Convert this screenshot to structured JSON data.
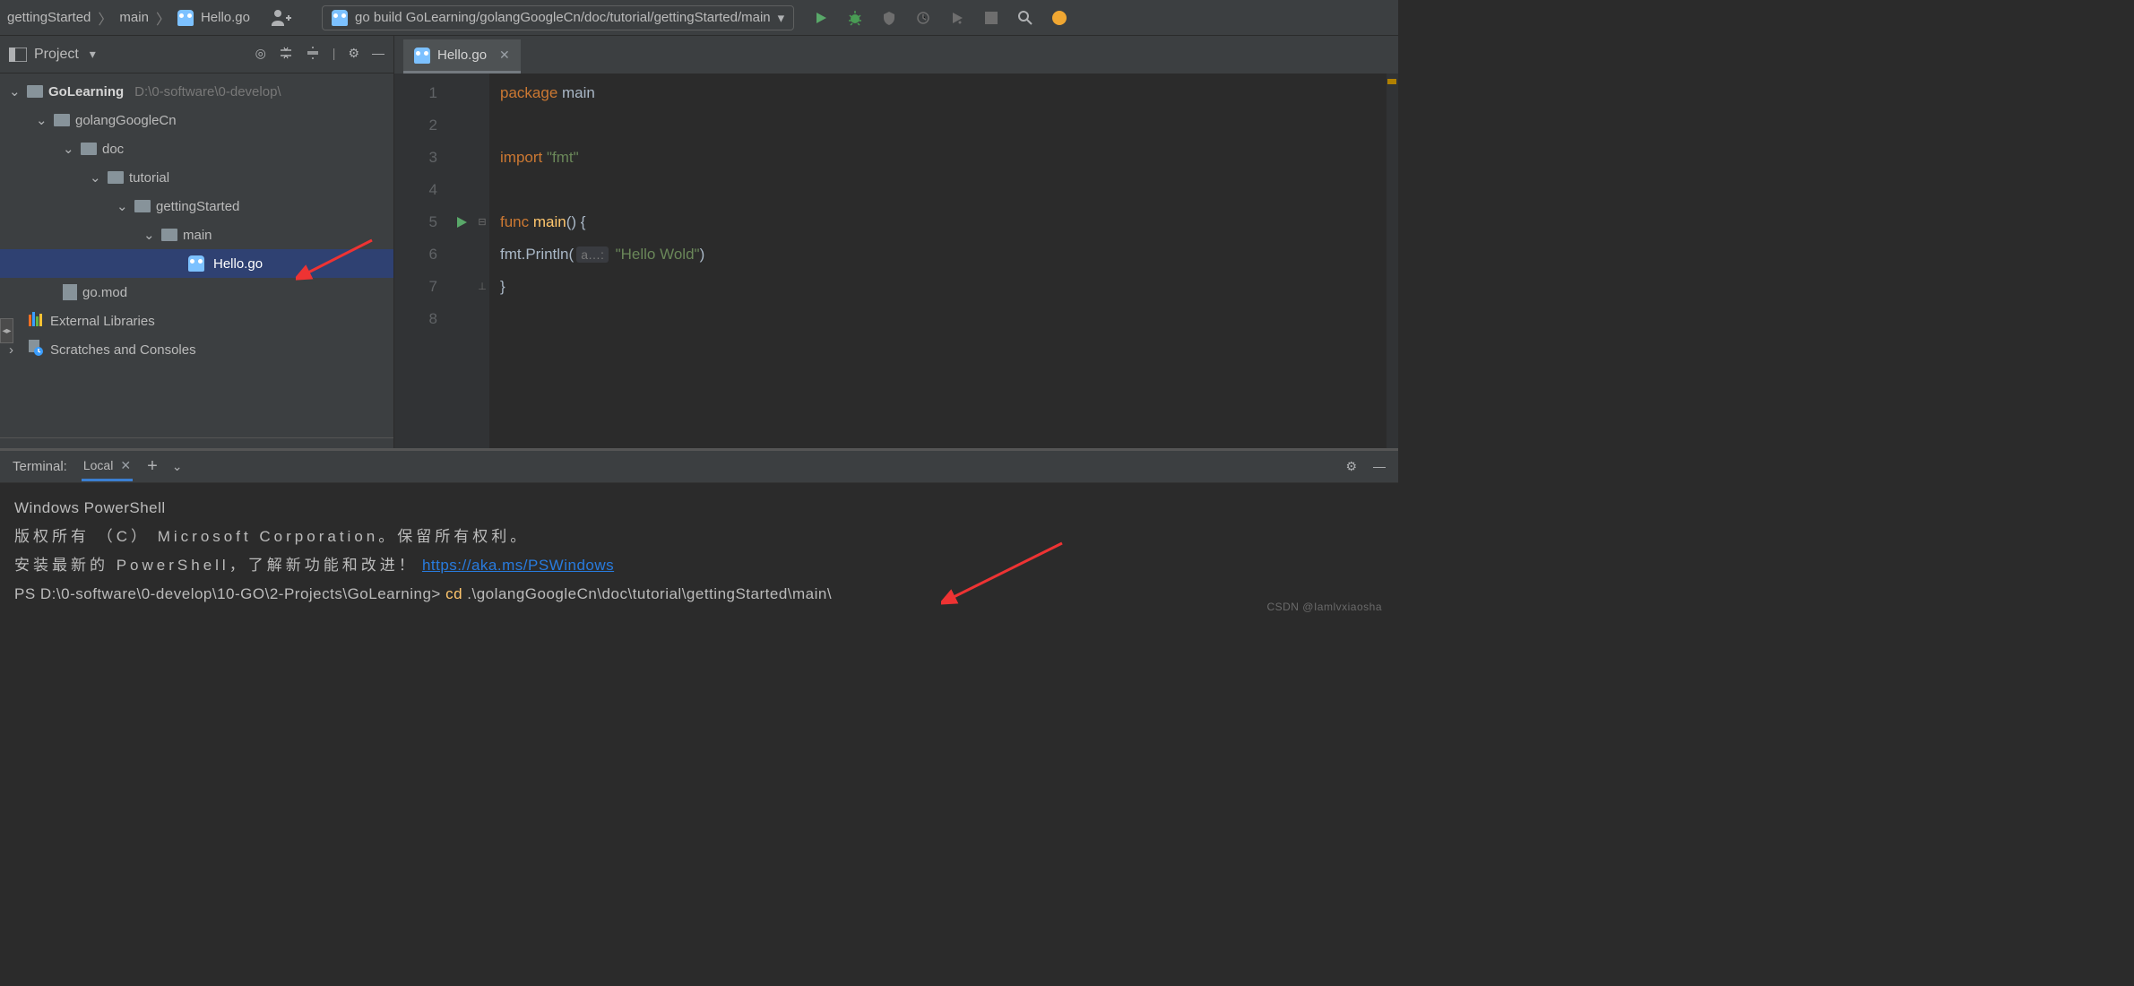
{
  "breadcrumb": {
    "p1": "gettingStarted",
    "p2": "main",
    "p3": "Hello.go"
  },
  "run_config": {
    "label": "go build GoLearning/golangGoogleCn/doc/tutorial/gettingStarted/main"
  },
  "project_panel": {
    "title": "Project"
  },
  "tree": {
    "root": "GoLearning",
    "root_path": "D:\\0-software\\0-develop\\",
    "n1": "golangGoogleCn",
    "n2": "doc",
    "n3": "tutorial",
    "n4": "gettingStarted",
    "n5": "main",
    "file1": "Hello.go",
    "file2": "go.mod",
    "ext": "External Libraries",
    "scratch": "Scratches and Consoles"
  },
  "tab": {
    "label": "Hello.go"
  },
  "code": {
    "l1_kw": "package",
    "l1_name": " main",
    "l3_kw": "import",
    "l3_str": " \"fmt\"",
    "l5_kw": "func ",
    "l5_fn": "main",
    "l5_rest": "() {",
    "l6_a": "    fmt.Println(",
    "l6_hint": "a…:",
    "l6_str": " \"Hello Wold\"",
    "l6_b": ")",
    "l7": "}",
    "lines": [
      "1",
      "2",
      "3",
      "4",
      "5",
      "6",
      "7",
      "8"
    ]
  },
  "terminal": {
    "panel": "Terminal:",
    "tab": "Local",
    "line1": "Windows PowerShell",
    "line2": "版权所有 （C） Microsoft Corporation。保留所有权利。",
    "line3a": "安装最新的 PowerShell，了解新功能和改进！",
    "line3_link": "https://aka.ms/PSWindows",
    "prompt": "PS D:\\0-software\\0-develop\\10-GO\\2-Projects\\GoLearning> ",
    "cmd": "cd ",
    "cmd_arg": ".\\golangGoogleCn\\doc\\tutorial\\gettingStarted\\main\\"
  },
  "watermark": "CSDN @Iamlvxiaosha"
}
